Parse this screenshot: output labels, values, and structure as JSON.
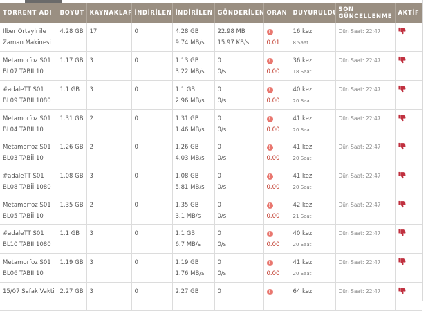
{
  "headers": {
    "name": "TORRENT ADI",
    "size": "BOYUT",
    "sources": "KAYNAKLAR",
    "downloads": "İNDİRİLEN",
    "downloaded": "İNDİRİLEN",
    "uploaded": "GÖNDERİLEN",
    "ratio": "ORAN",
    "announced": "DUYURULDU",
    "last_update_1": "SON",
    "last_update_2": "GÜNCELLENME",
    "active": "AKTİF"
  },
  "icons": {
    "ratio_warning": "warning-icon",
    "active": "thumbs-down-icon"
  },
  "colors": {
    "header_bg": "#9a8f82",
    "ratio_red": "#c0392b",
    "warning": "#e9776f",
    "thumb": "#c0303f"
  },
  "rows": [
    {
      "name1": "İlber Ortaylı ile",
      "name2": "Zaman Makinesi",
      "size": "4.28 GB",
      "sources": "17",
      "downloads": "0",
      "dl": "4.28 GB",
      "dl_speed": "9.74 MB/s",
      "up": "22.98 MB",
      "up_speed": "15.97 KB/s",
      "ratio": "0.01",
      "announced": "16 kez",
      "announced_time": "8 Saat",
      "updated": "Dün Saat: 22:47"
    },
    {
      "name1": "Metamorfoz S01",
      "name2": "BL07 TABİİ 10",
      "size": "1.17 GB",
      "sources": "3",
      "downloads": "0",
      "dl": "1.13 GB",
      "dl_speed": "3.22 MB/s",
      "up": "0",
      "up_speed": "0/s",
      "ratio": "0.00",
      "announced": "36 kez",
      "announced_time": "18 Saat",
      "updated": "Dün Saat: 22:47"
    },
    {
      "name1": "#adaleTT S01",
      "name2": "BL09 TABİİ 1080",
      "size": "1.1 GB",
      "sources": "3",
      "downloads": "0",
      "dl": "1.1 GB",
      "dl_speed": "2.96 MB/s",
      "up": "0",
      "up_speed": "0/s",
      "ratio": "0.00",
      "announced": "40 kez",
      "announced_time": "20 Saat",
      "updated": "Dün Saat: 22:47"
    },
    {
      "name1": "Metamorfoz S01",
      "name2": "BL04 TABİİ 10",
      "size": "1.31 GB",
      "sources": "2",
      "downloads": "0",
      "dl": "1.31 GB",
      "dl_speed": "1.46 MB/s",
      "up": "0",
      "up_speed": "0/s",
      "ratio": "0.00",
      "announced": "41 kez",
      "announced_time": "20 Saat",
      "updated": "Dün Saat: 22:47"
    },
    {
      "name1": "Metamorfoz S01",
      "name2": "BL03 TABİİ 10",
      "size": "1.26 GB",
      "sources": "2",
      "downloads": "0",
      "dl": "1.26 GB",
      "dl_speed": "4.03 MB/s",
      "up": "0",
      "up_speed": "0/s",
      "ratio": "0.00",
      "announced": "41 kez",
      "announced_time": "20 Saat",
      "updated": "Dün Saat: 22:47"
    },
    {
      "name1": "#adaleTT S01",
      "name2": "BL08 TABİİ 1080",
      "size": "1.08 GB",
      "sources": "3",
      "downloads": "0",
      "dl": "1.08 GB",
      "dl_speed": "5.81 MB/s",
      "up": "0",
      "up_speed": "0/s",
      "ratio": "0.00",
      "announced": "41 kez",
      "announced_time": "20 Saat",
      "updated": "Dün Saat: 22:47"
    },
    {
      "name1": "Metamorfoz S01",
      "name2": "BL05 TABİİ 10",
      "size": "1.35 GB",
      "sources": "2",
      "downloads": "0",
      "dl": "1.35 GB",
      "dl_speed": "3.1 MB/s",
      "up": "0",
      "up_speed": "0/s",
      "ratio": "0.00",
      "announced": "42 kez",
      "announced_time": "21 Saat",
      "updated": "Dün Saat: 22:47"
    },
    {
      "name1": "#adaleTT S01",
      "name2": "BL10 TABİİ 1080",
      "size": "1.1 GB",
      "sources": "3",
      "downloads": "0",
      "dl": "1.1 GB",
      "dl_speed": "6.7 MB/s",
      "up": "0",
      "up_speed": "0/s",
      "ratio": "0.00",
      "announced": "40 kez",
      "announced_time": "20 Saat",
      "updated": "Dün Saat: 22:47"
    },
    {
      "name1": "Metamorfoz S01",
      "name2": "BL06 TABİİ 10",
      "size": "1.19 GB",
      "sources": "3",
      "downloads": "0",
      "dl": "1.19 GB",
      "dl_speed": "1.76 MB/s",
      "up": "0",
      "up_speed": "0/s",
      "ratio": "0.00",
      "announced": "41 kez",
      "announced_time": "20 Saat",
      "updated": "Dün Saat: 22:47"
    },
    {
      "name1": "15/07 Şafak Vakti",
      "name2": "",
      "size": "2.27 GB",
      "sources": "3",
      "downloads": "0",
      "dl": "2.27 GB",
      "dl_speed": "",
      "up": "0",
      "up_speed": "",
      "ratio": "",
      "announced": "64 kez",
      "announced_time": "",
      "updated": "Dün Saat: 22:47"
    }
  ]
}
